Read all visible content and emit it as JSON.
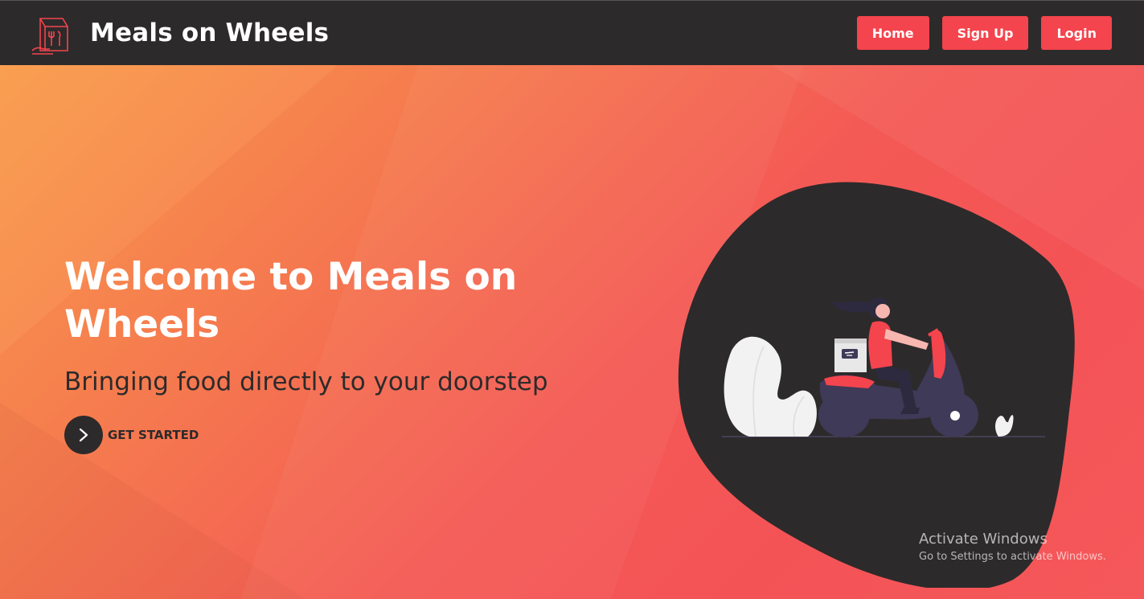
{
  "navbar": {
    "brand_title": "Meals on Wheels",
    "logo_icon": "food-bag-logo-icon",
    "buttons": {
      "home": "Home",
      "signup": "Sign Up",
      "login": "Login"
    }
  },
  "hero": {
    "title": "Welcome to Meals on Wheels",
    "subtitle": "Bringing food directly to your doorstep",
    "cta_label": "GET STARTED",
    "cta_icon": "chevron-right-icon",
    "illustration": "scooter-delivery-illustration"
  },
  "watermark": {
    "title": "Activate Windows",
    "subtitle": "Go to Settings to activate Windows."
  },
  "colors": {
    "navbar_bg": "#2d2a2b",
    "accent": "#f4444d",
    "gradient_start": "#f99b4c",
    "gradient_end": "#f45356",
    "blob": "#2d2a2b"
  }
}
